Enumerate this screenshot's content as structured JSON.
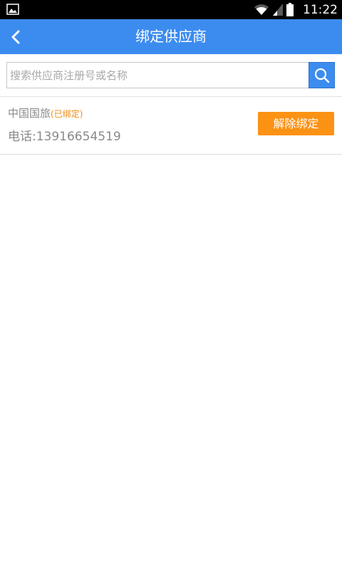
{
  "status_bar": {
    "time": "11:22",
    "icons": [
      "gallery-icon",
      "wifi-icon",
      "signal-icon",
      "battery-icon"
    ]
  },
  "header": {
    "title": "绑定供应商",
    "back_icon": "chevron-left-icon",
    "background_color": "#3c8cf0"
  },
  "search": {
    "placeholder": "搜索供应商注册号或名称",
    "value": "",
    "button_icon": "search-icon"
  },
  "suppliers": [
    {
      "name": "中国国旅",
      "status": "(已绑定)",
      "phone": "电话:13916654519",
      "action_label": "解除绑定"
    }
  ],
  "colors": {
    "accent": "#3c8cf0",
    "action": "#fb9214",
    "status_text": "#f08c14",
    "muted_text": "#8a8a8a"
  }
}
